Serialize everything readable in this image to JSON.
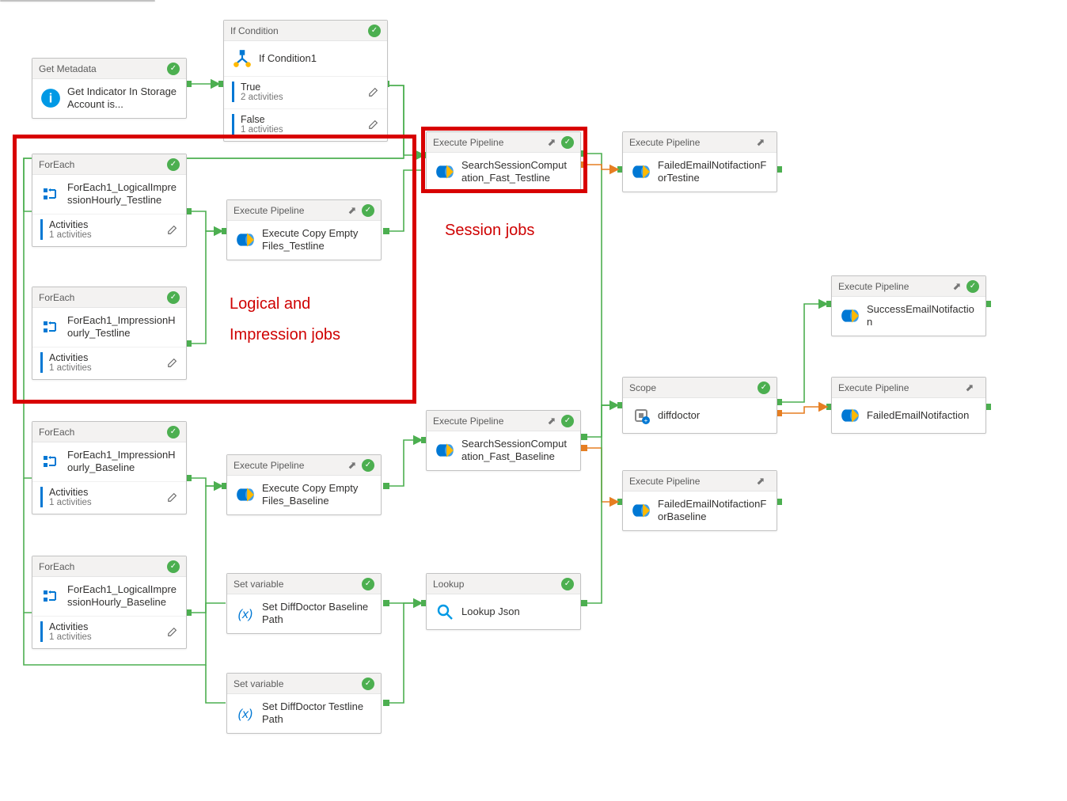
{
  "annotations": {
    "box1_label1": "Logical and",
    "box1_label2": "Impression jobs",
    "box2_label": "Session jobs"
  },
  "nodes": {
    "getMetadata": {
      "type": "Get Metadata",
      "title": "Get Indicator In Storage Account is..."
    },
    "ifCondition": {
      "type": "If Condition",
      "title": "If Condition1",
      "rows": [
        {
          "label": "True",
          "count": "2 activities"
        },
        {
          "label": "False",
          "count": "1 activities"
        }
      ]
    },
    "foreach1": {
      "type": "ForEach",
      "title": "ForEach1_LogicalImpressionHourly_Testline",
      "row": {
        "label": "Activities",
        "count": "1 activities"
      }
    },
    "foreach2": {
      "type": "ForEach",
      "title": "ForEach1_ImpressionHourly_Testline",
      "row": {
        "label": "Activities",
        "count": "1 activities"
      }
    },
    "execCopyTest": {
      "type": "Execute Pipeline",
      "title": "Execute Copy Empty Files_Testline"
    },
    "searchTest": {
      "type": "Execute Pipeline",
      "title": "SearchSessionComputation_Fast_Testline"
    },
    "failedTest": {
      "type": "Execute Pipeline",
      "title": "FailedEmailNotifactionForTestine"
    },
    "foreach3": {
      "type": "ForEach",
      "title": "ForEach1_ImpressionHourly_Baseline",
      "row": {
        "label": "Activities",
        "count": "1 activities"
      }
    },
    "foreach4": {
      "type": "ForEach",
      "title": "ForEach1_LogicalImpressionHourly_Baseline",
      "row": {
        "label": "Activities",
        "count": "1 activities"
      }
    },
    "execCopyBase": {
      "type": "Execute Pipeline",
      "title": "Execute Copy Empty Files_Baseline"
    },
    "searchBase": {
      "type": "Execute Pipeline",
      "title": "SearchSessionComputation_Fast_Baseline"
    },
    "failedBase": {
      "type": "Execute Pipeline",
      "title": "FailedEmailNotifactionForBaseline"
    },
    "scope": {
      "type": "Scope",
      "title": "diffdoctor"
    },
    "successEmail": {
      "type": "Execute Pipeline",
      "title": "SuccessEmailNotifaction"
    },
    "failedEmail": {
      "type": "Execute Pipeline",
      "title": "FailedEmailNotifaction"
    },
    "setVarBase": {
      "type": "Set variable",
      "title": "Set DiffDoctor Baseline Path"
    },
    "setVarTest": {
      "type": "Set variable",
      "title": "Set DiffDoctor Testline Path"
    },
    "lookup": {
      "type": "Lookup",
      "title": "Lookup Json"
    }
  }
}
